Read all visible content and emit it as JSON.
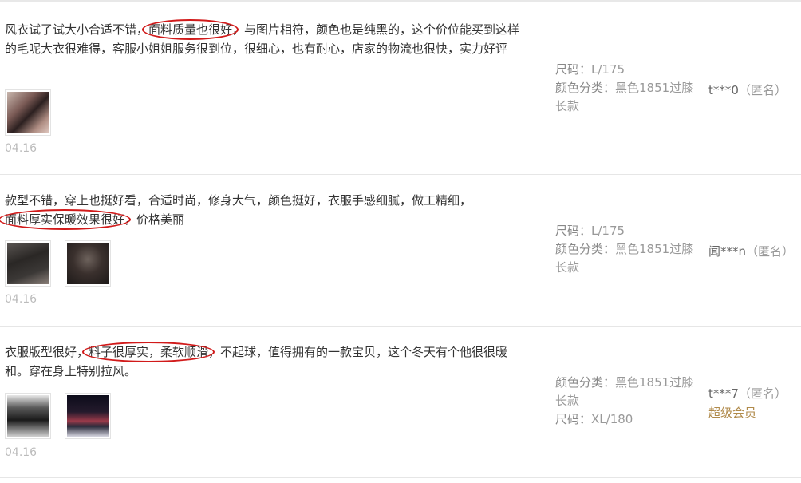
{
  "reviews": [
    {
      "text_a": "风衣试了试大小合适不错，",
      "highlight": "面料质量也很好",
      "text_b": "，与图片相符，颜色也是纯黑的，这个价位能买到这样的毛呢大衣很难得，客服小姐姐服务很到位，很细心，也有耐心，店家的物流也很快，实力好评",
      "date": "04.16",
      "specs": [
        {
          "key": "尺码：",
          "value": "L/175"
        },
        {
          "key": "颜色分类：",
          "value": "黑色1851过膝长款"
        }
      ],
      "user": "t***0",
      "anon": "（匿名）",
      "badge": ""
    },
    {
      "text_a": "款型不错，穿上也挺好看，合适时尚，修身大气，颜色挺好，衣服手感细腻，做工精细，",
      "highlight": "面料厚实保暖效果很好",
      "text_b": "，价格美丽",
      "date": "04.16",
      "specs": [
        {
          "key": "尺码：",
          "value": "L/175"
        },
        {
          "key": "颜色分类：",
          "value": "黑色1851过膝长款"
        }
      ],
      "user": "闻***n",
      "anon": "（匿名）",
      "badge": ""
    },
    {
      "text_a": "衣服版型很好，",
      "highlight": "料子很厚实，柔软顺滑",
      "text_b": "，不起球，值得拥有的一款宝贝，这个冬天有个他很很暖和。穿在身上特别拉风。",
      "date": "04.16",
      "specs": [
        {
          "key": "颜色分类：",
          "value": "黑色1851过膝长款"
        },
        {
          "key": "尺码：",
          "value": "XL/180"
        }
      ],
      "user": "t***7",
      "anon": "（匿名）",
      "badge": "超级会员"
    }
  ]
}
